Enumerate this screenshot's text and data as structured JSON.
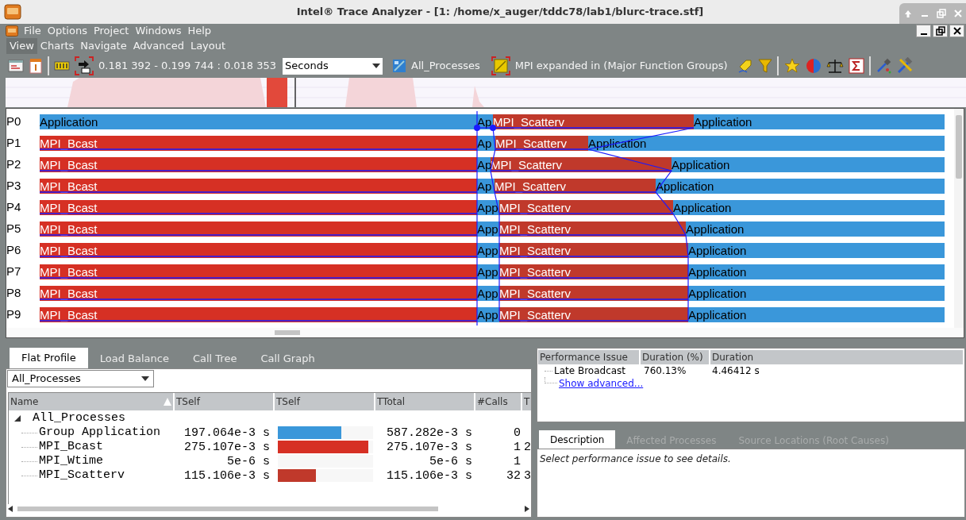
{
  "window": {
    "title": "Intel® Trace Analyzer - [1: /home/x_auger/tddc78/lab1/blurc-trace.stf]"
  },
  "menu_bar": [
    "File",
    "Options",
    "Project",
    "Windows",
    "Help"
  ],
  "chart_menu": [
    {
      "label": "View",
      "selected": true
    },
    {
      "label": "Charts",
      "selected": false
    },
    {
      "label": "Navigate",
      "selected": false
    },
    {
      "label": "Advanced",
      "selected": false
    },
    {
      "label": "Layout",
      "selected": false
    }
  ],
  "toolbar": {
    "time_range": "0.181 392 - 0.199 744 : 0.018 353",
    "unit": "Seconds",
    "process_group": "All_Processes",
    "function_grouping": "MPI expanded in (Major Function Groups)"
  },
  "event_timeline": {
    "rows": [
      {
        "process": "P0",
        "segments": [
          {
            "kind": "application",
            "label": "Application",
            "color": "#3a97da"
          },
          {
            "kind": "application",
            "label": "Ap",
            "color": "#3a97da"
          },
          {
            "kind": "mpi",
            "label": "MPI_Scatterv",
            "color": "#c0392b"
          },
          {
            "kind": "application",
            "label": "Application",
            "color": "#3a97da"
          }
        ]
      },
      {
        "process": "P1",
        "segments": [
          {
            "kind": "mpi",
            "label": "MPI_Bcast",
            "color": "#d63024"
          },
          {
            "kind": "application",
            "label": "Ap",
            "color": "#3a97da"
          },
          {
            "kind": "mpi",
            "label": "MPI_Scatterv",
            "color": "#c0392b"
          },
          {
            "kind": "application",
            "label": "Application",
            "color": "#3a97da"
          }
        ]
      },
      {
        "process": "P2",
        "segments": [
          {
            "kind": "mpi",
            "label": "MPI_Bcast",
            "color": "#d63024"
          },
          {
            "kind": "application",
            "label": "Ap",
            "color": "#3a97da"
          },
          {
            "kind": "mpi",
            "label": "MPI_Scatterv",
            "color": "#c0392b"
          },
          {
            "kind": "application",
            "label": "Application",
            "color": "#3a97da"
          }
        ]
      },
      {
        "process": "P3",
        "segments": [
          {
            "kind": "mpi",
            "label": "MPI_Bcast",
            "color": "#d63024"
          },
          {
            "kind": "application",
            "label": "Ap",
            "color": "#3a97da"
          },
          {
            "kind": "mpi",
            "label": "MPI_Scatterv",
            "color": "#c0392b"
          },
          {
            "kind": "application",
            "label": "Application",
            "color": "#3a97da"
          }
        ]
      },
      {
        "process": "P4",
        "segments": [
          {
            "kind": "mpi",
            "label": "MPI_Bcast",
            "color": "#d63024"
          },
          {
            "kind": "application",
            "label": "App",
            "color": "#3a97da"
          },
          {
            "kind": "mpi",
            "label": "MPI_Scatterv",
            "color": "#c0392b"
          },
          {
            "kind": "application",
            "label": "Application",
            "color": "#3a97da"
          }
        ]
      },
      {
        "process": "P5",
        "segments": [
          {
            "kind": "mpi",
            "label": "MPI_Bcast",
            "color": "#d63024"
          },
          {
            "kind": "application",
            "label": "App",
            "color": "#3a97da"
          },
          {
            "kind": "mpi",
            "label": "MPI_Scatterv",
            "color": "#c0392b"
          },
          {
            "kind": "application",
            "label": "Application",
            "color": "#3a97da"
          }
        ]
      },
      {
        "process": "P6",
        "segments": [
          {
            "kind": "mpi",
            "label": "MPI_Bcast",
            "color": "#d63024"
          },
          {
            "kind": "application",
            "label": "App",
            "color": "#3a97da"
          },
          {
            "kind": "mpi",
            "label": "MPI_Scatterv",
            "color": "#c0392b"
          },
          {
            "kind": "application",
            "label": "Application",
            "color": "#3a97da"
          }
        ]
      },
      {
        "process": "P7",
        "segments": [
          {
            "kind": "mpi",
            "label": "MPI_Bcast",
            "color": "#d63024"
          },
          {
            "kind": "application",
            "label": "App",
            "color": "#3a97da"
          },
          {
            "kind": "mpi",
            "label": "MPI_Scatterv",
            "color": "#c0392b"
          },
          {
            "kind": "application",
            "label": "Application",
            "color": "#3a97da"
          }
        ]
      },
      {
        "process": "P8",
        "segments": [
          {
            "kind": "mpi",
            "label": "MPI_Bcast",
            "color": "#d63024"
          },
          {
            "kind": "application",
            "label": "App",
            "color": "#3a97da"
          },
          {
            "kind": "mpi",
            "label": "MPI_Scatterv",
            "color": "#c0392b"
          },
          {
            "kind": "application",
            "label": "Application",
            "color": "#3a97da"
          }
        ]
      },
      {
        "process": "P9",
        "segments": [
          {
            "kind": "mpi",
            "label": "MPI_Bcast",
            "color": "#d63024"
          },
          {
            "kind": "application",
            "label": "App",
            "color": "#3a97da"
          },
          {
            "kind": "mpi",
            "label": "MPI_Scatterv",
            "color": "#c0392b"
          },
          {
            "kind": "application",
            "label": "Application",
            "color": "#3a97da"
          }
        ]
      }
    ]
  },
  "profile": {
    "tabs": [
      {
        "label": "Flat Profile",
        "selected": true
      },
      {
        "label": "Load Balance",
        "selected": false
      },
      {
        "label": "Call Tree",
        "selected": false
      },
      {
        "label": "Call Graph",
        "selected": false
      }
    ],
    "filter": "All_Processes",
    "columns": [
      {
        "label": "Name",
        "sorted": true
      },
      {
        "label": "TSelf",
        "sorted": false
      },
      {
        "label": "TSelf",
        "sorted": false
      },
      {
        "label": "TTotal",
        "sorted": false
      },
      {
        "label": "#Calls",
        "sorted": false
      },
      {
        "label": "T",
        "sorted": false
      }
    ],
    "tree": {
      "label": "All_Processes",
      "expanded": true,
      "children": [
        {
          "name": "Group Application",
          "tself": "197.064e-3 s",
          "level": 0.67,
          "color": "#3a97da",
          "ttotal": "587.282e-3 s",
          "calls": "0"
        },
        {
          "name": "MPI_Bcast",
          "tself": "275.107e-3 s",
          "level": 0.95,
          "color": "#d63024",
          "ttotal": "275.107e-3 s",
          "calls": "1",
          "column_6": "2"
        },
        {
          "name": "MPI_Wtime",
          "tself": "5e-6 s",
          "ttotal": "5e-6 s",
          "calls": "1"
        },
        {
          "name": "MPI_Scatterv",
          "tself": "115.106e-3 s",
          "level": 0.4,
          "color": "#c0392b",
          "ttotal": "115.106e-3 s",
          "calls": "32",
          "column_6": "3"
        }
      ]
    }
  },
  "performance_issues": {
    "columns": [
      "Performance Issue",
      "Duration (%)",
      "Duration"
    ],
    "rows": [
      {
        "issue": "Late Broadcast",
        "duration_pct": "760.13%",
        "duration": "4.46412 s"
      }
    ],
    "link": "Show advanced..."
  },
  "details": {
    "tabs": [
      {
        "label": "Description",
        "selected": true
      },
      {
        "label": "Affected Processes",
        "selected": false
      },
      {
        "label": "Source Locations (Root Causes)",
        "selected": false
      }
    ],
    "text": "Select performance issue to see details."
  }
}
